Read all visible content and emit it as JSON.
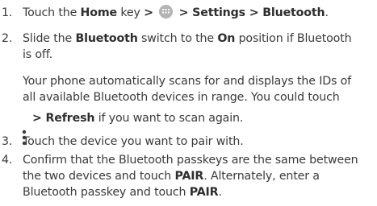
{
  "steps": [
    {
      "number": "1.",
      "pre": "Touch the",
      "home": "Home",
      "key": "key",
      "gt1": ">",
      "icon": "apps-icon",
      "path": "> Settings > Bluetooth",
      "dot": "."
    },
    {
      "number": "2.",
      "line1_a": "Slide the",
      "line1_b": "Bluetooth",
      "line1_c": "switch to the",
      "line1_d": "On",
      "line1_e": "position if Bluetooth",
      "line2": "is off.",
      "note_line1": "Your phone automatically scans for and displays the IDs of",
      "note_line2": "all available Bluetooth devices in range. You could touch",
      "note_icon": "more-vert-icon",
      "note_line3_b": "> Refresh",
      "note_line3_c": "if you want to scan again."
    },
    {
      "number": "3.",
      "text": "Touch the device you want to pair with."
    },
    {
      "number": "4.",
      "line1": "Confirm that the Bluetooth passkeys are the same between",
      "line2_a": "the two devices and touch",
      "line2_b": "PAIR",
      "line2_c": ". Alternately, enter a",
      "line3_a": "Bluetooth passkey and touch",
      "line3_b": "PAIR",
      "line3_c": "."
    }
  ]
}
